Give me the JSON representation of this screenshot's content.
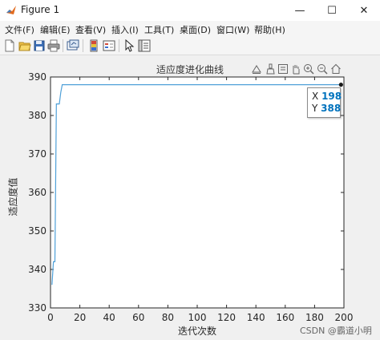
{
  "window": {
    "title": "Figure 1",
    "controls": {
      "minimize": "—",
      "maximize": "☐",
      "close": "✕"
    }
  },
  "menubar": {
    "items": [
      {
        "label": "文件(F)"
      },
      {
        "label": "编辑(E)"
      },
      {
        "label": "查看(V)"
      },
      {
        "label": "插入(I)"
      },
      {
        "label": "工具(T)"
      },
      {
        "label": "桌面(D)"
      },
      {
        "label": "窗口(W)"
      },
      {
        "label": "帮助(H)"
      }
    ]
  },
  "toolbar": {
    "icons": [
      "new-figure-icon",
      "open-file-icon",
      "save-icon",
      "print-icon",
      "link-plot-icon",
      "insert-colorbar-icon",
      "insert-legend-icon",
      "edit-plot-icon",
      "property-inspector-icon"
    ]
  },
  "axes_toolbar": {
    "icons": [
      "export-icon",
      "brush-icon",
      "datatip-icon",
      "pan-icon",
      "zoom-in-icon",
      "zoom-out-icon",
      "home-icon"
    ]
  },
  "chart_data": {
    "type": "line",
    "title": "适应度进化曲线",
    "xlabel": "迭代次数",
    "ylabel": "适应度值",
    "xlim": [
      0,
      200
    ],
    "ylim": [
      330,
      390
    ],
    "xticks": [
      0,
      20,
      40,
      60,
      80,
      100,
      120,
      140,
      160,
      180,
      200
    ],
    "yticks": [
      330,
      340,
      350,
      360,
      370,
      380,
      390
    ],
    "grid": false,
    "line_color": "#4fa0d8",
    "series": [
      {
        "x": [
          1,
          2,
          3,
          4,
          5,
          6,
          7,
          8,
          198
        ],
        "y": [
          336,
          342,
          342,
          383,
          383,
          383,
          386,
          388,
          388
        ]
      }
    ],
    "datatip": {
      "x_label": "X",
      "x_value": "198",
      "y_label": "Y",
      "y_value": "388"
    }
  },
  "watermark": "CSDN @霸道小明"
}
